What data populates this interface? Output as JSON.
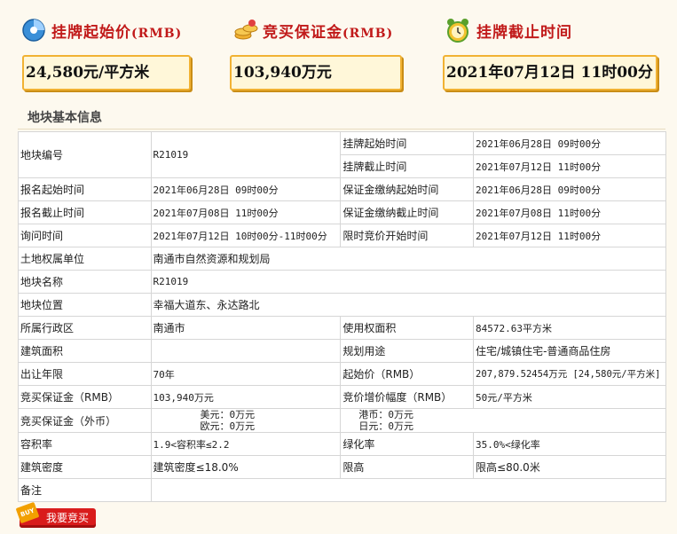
{
  "summary": {
    "start_price": {
      "title": "挂牌起始价",
      "unit": "(RMB)",
      "value": "24,580元/平方米",
      "icon": "pie-chart-icon"
    },
    "deposit": {
      "title": "竞买保证金",
      "unit": "(RMB)",
      "value": "103,940万元",
      "icon": "coins-icon"
    },
    "deadline": {
      "title": "挂牌截止时间",
      "value": "2021年07月12日  11时00分",
      "icon": "alarm-clock-icon"
    }
  },
  "section_title": "地块基本信息",
  "table": {
    "parcel_no_label": "地块编号",
    "parcel_no": "R21019",
    "list_start_label": "挂牌起始时间",
    "list_start": "2021年06月28日 09时00分",
    "list_end_label": "挂牌截止时间",
    "list_end": "2021年07月12日 11时00分",
    "reg_start_label": "报名起始时间",
    "reg_start": "2021年06月28日 09时00分",
    "dep_start_label": "保证金缴纳起始时间",
    "dep_start": "2021年06月28日 09时00分",
    "reg_end_label": "报名截止时间",
    "reg_end": "2021年07月08日 11时00分",
    "dep_end_label": "保证金缴纳截止时间",
    "dep_end": "2021年07月08日 11时00分",
    "inquiry_label": "询问时间",
    "inquiry": "2021年07月12日 10时00分-11时00分",
    "bid_start_label": "限时竞价开始时间",
    "bid_start": "2021年07月12日 11时00分",
    "owner_label": "土地权属单位",
    "owner": "南通市自然资源和规划局",
    "name_label": "地块名称",
    "name": "R21019",
    "location_label": "地块位置",
    "location": "幸福大道东、永达路北",
    "district_label": "所属行政区",
    "district": "南通市",
    "use_area_label": "使用权面积",
    "use_area": "84572.63平方米",
    "build_area_label": "建筑面积",
    "build_area": "",
    "purpose_label": "规划用途",
    "purpose": "住宅/城镇住宅-普通商品住房",
    "term_label": "出让年限",
    "term": "70年",
    "start_price_label": "起始价（RMB）",
    "start_price": "207,879.52454万元 [24,580元/平方米]",
    "deposit_rmb_label": "竞买保证金（RMB）",
    "deposit_rmb": "103,940万元",
    "increment_label": "竞价增价幅度（RMB）",
    "increment": "50元/平方米",
    "deposit_fx_label": "竞买保证金（外币）",
    "usd": "美元：0万元",
    "eur": "欧元：0万元",
    "hkd": "港币：0万元",
    "jpy": "日元：0万元",
    "far_label": "容积率",
    "far": "1.9<容积率≤2.2",
    "green_label": "绿化率",
    "green": "35.0%<绿化率",
    "density_label": "建筑密度",
    "density": "建筑密度≤18.0%",
    "height_label": "限高",
    "height": "限高≤80.0米",
    "remark_label": "备注",
    "remark": ""
  },
  "buy_button": {
    "label": "我要竞买",
    "tag": "BUY"
  },
  "colors": {
    "accent": "#c11a1a",
    "box_border": "#f1b233",
    "button": "#d91c1c"
  }
}
